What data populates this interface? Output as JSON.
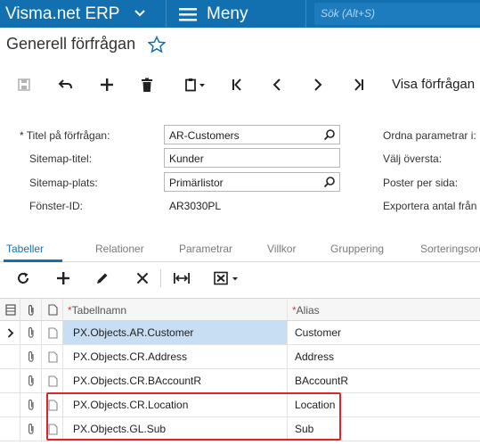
{
  "header": {
    "brand": "Visma.net ERP",
    "menu_label": "Meny",
    "search_placeholder": "Sök (Alt+S)"
  },
  "page": {
    "title": "Generell förfrågan"
  },
  "toolbar": {
    "visa_label": "Visa förfrågan"
  },
  "form": {
    "title_label": "Titel på förfrågan:",
    "title_value": "AR-Customers",
    "sitemap_title_label": "Sitemap-titel:",
    "sitemap_title_value": "Kunder",
    "sitemap_place_label": "Sitemap-plats:",
    "sitemap_place_value": "Primärlistor",
    "window_id_label": "Fönster-ID:",
    "window_id_value": "AR3030PL",
    "right_labels": [
      "Ordna parametrar i:",
      "Välj översta:",
      "Poster per sida:",
      "Exportera antal från t"
    ]
  },
  "tabs": [
    "Tabeller",
    "Relationer",
    "Parametrar",
    "Villkor",
    "Gruppering",
    "Sorteringsordn"
  ],
  "grid": {
    "headers": {
      "table_name": "Tabellnamn",
      "alias": "Alias"
    },
    "rows": [
      {
        "table": "PX.Objects.AR.Customer",
        "alias": "Customer"
      },
      {
        "table": "PX.Objects.CR.Address",
        "alias": "Address"
      },
      {
        "table": "PX.Objects.CR.BAccountR",
        "alias": "BAccountR"
      },
      {
        "table": "PX.Objects.CR.Location",
        "alias": "Location"
      },
      {
        "table": "PX.Objects.GL.Sub",
        "alias": "Sub"
      }
    ]
  },
  "colors": {
    "topbar": "#1370b0",
    "accent": "#1370b0",
    "highlight_border": "#d9262d",
    "selected_cell": "#c8def3"
  }
}
